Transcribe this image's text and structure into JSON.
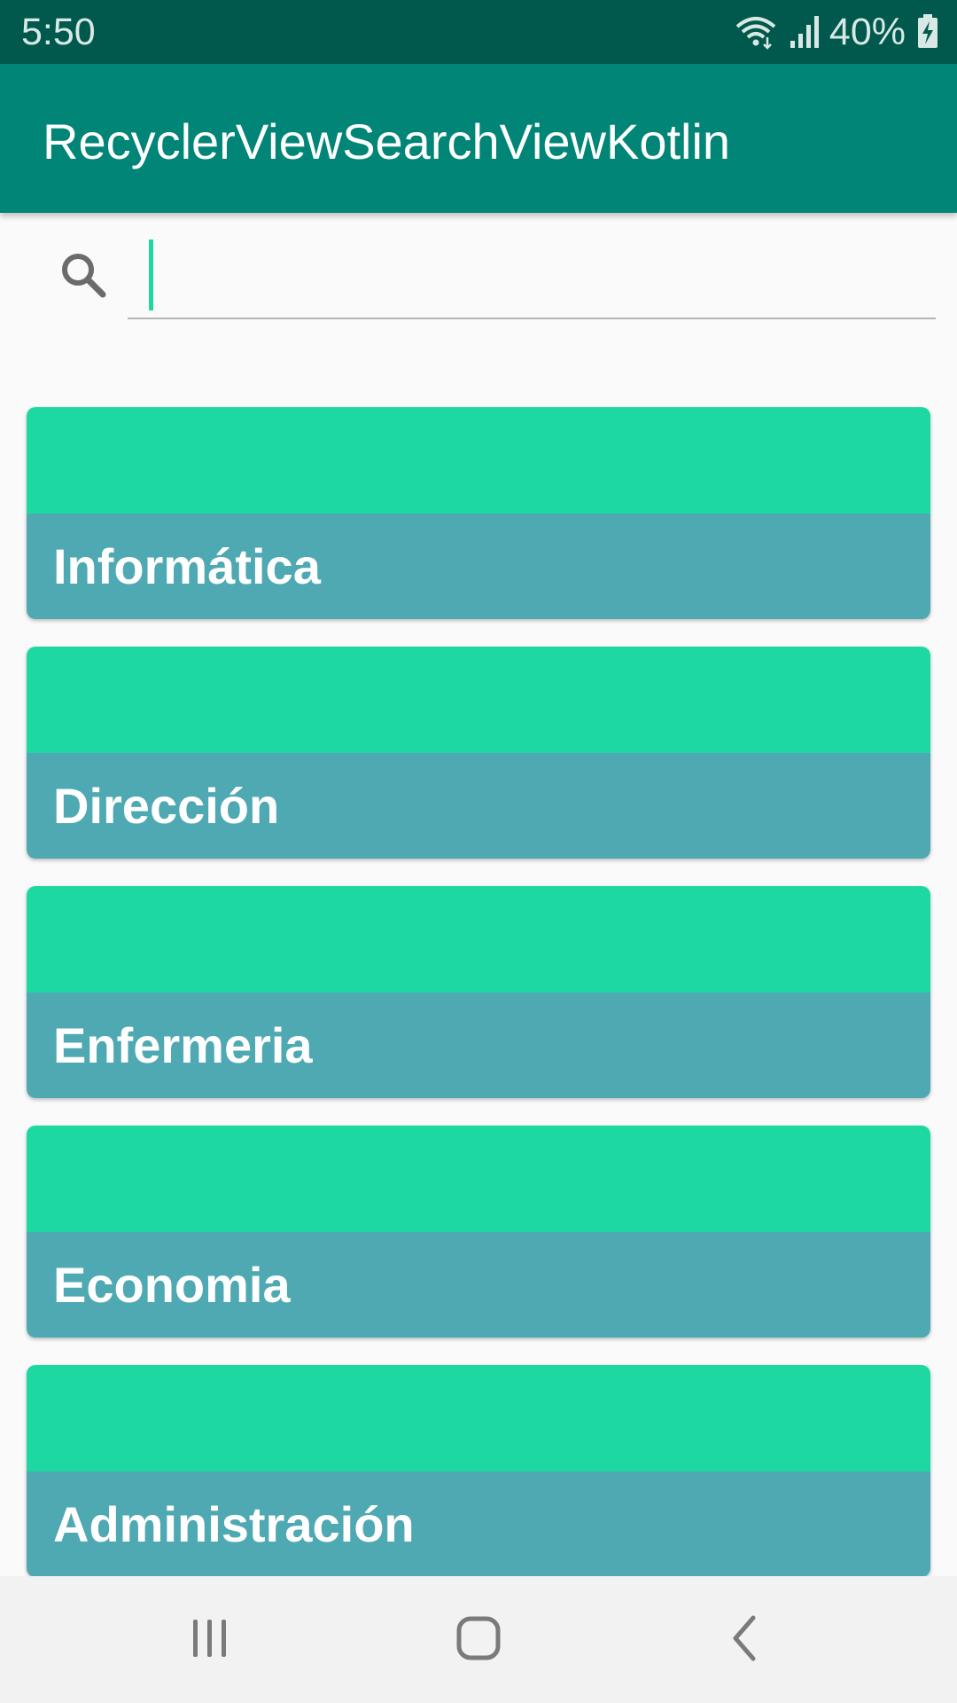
{
  "status_bar": {
    "time": "5:50",
    "battery": "40%",
    "icons": [
      "wifi-icon",
      "signal-icon",
      "battery-charging-icon"
    ]
  },
  "app_bar": {
    "title": "RecyclerViewSearchViewKotlin",
    "color": "#008577"
  },
  "search": {
    "value": "",
    "placeholder": "",
    "icon": "search-icon",
    "caret_color": "#1ed8a1"
  },
  "list": {
    "items": [
      {
        "label": "Informática"
      },
      {
        "label": "Dirección"
      },
      {
        "label": "Enfermeria"
      },
      {
        "label": "Economia"
      },
      {
        "label": "Administración"
      }
    ],
    "card_top_color": "#1ed8a1",
    "card_bottom_color": "#4ea9b2"
  },
  "nav_bar": {
    "buttons": [
      "recent-apps-icon",
      "home-icon",
      "back-icon"
    ]
  }
}
